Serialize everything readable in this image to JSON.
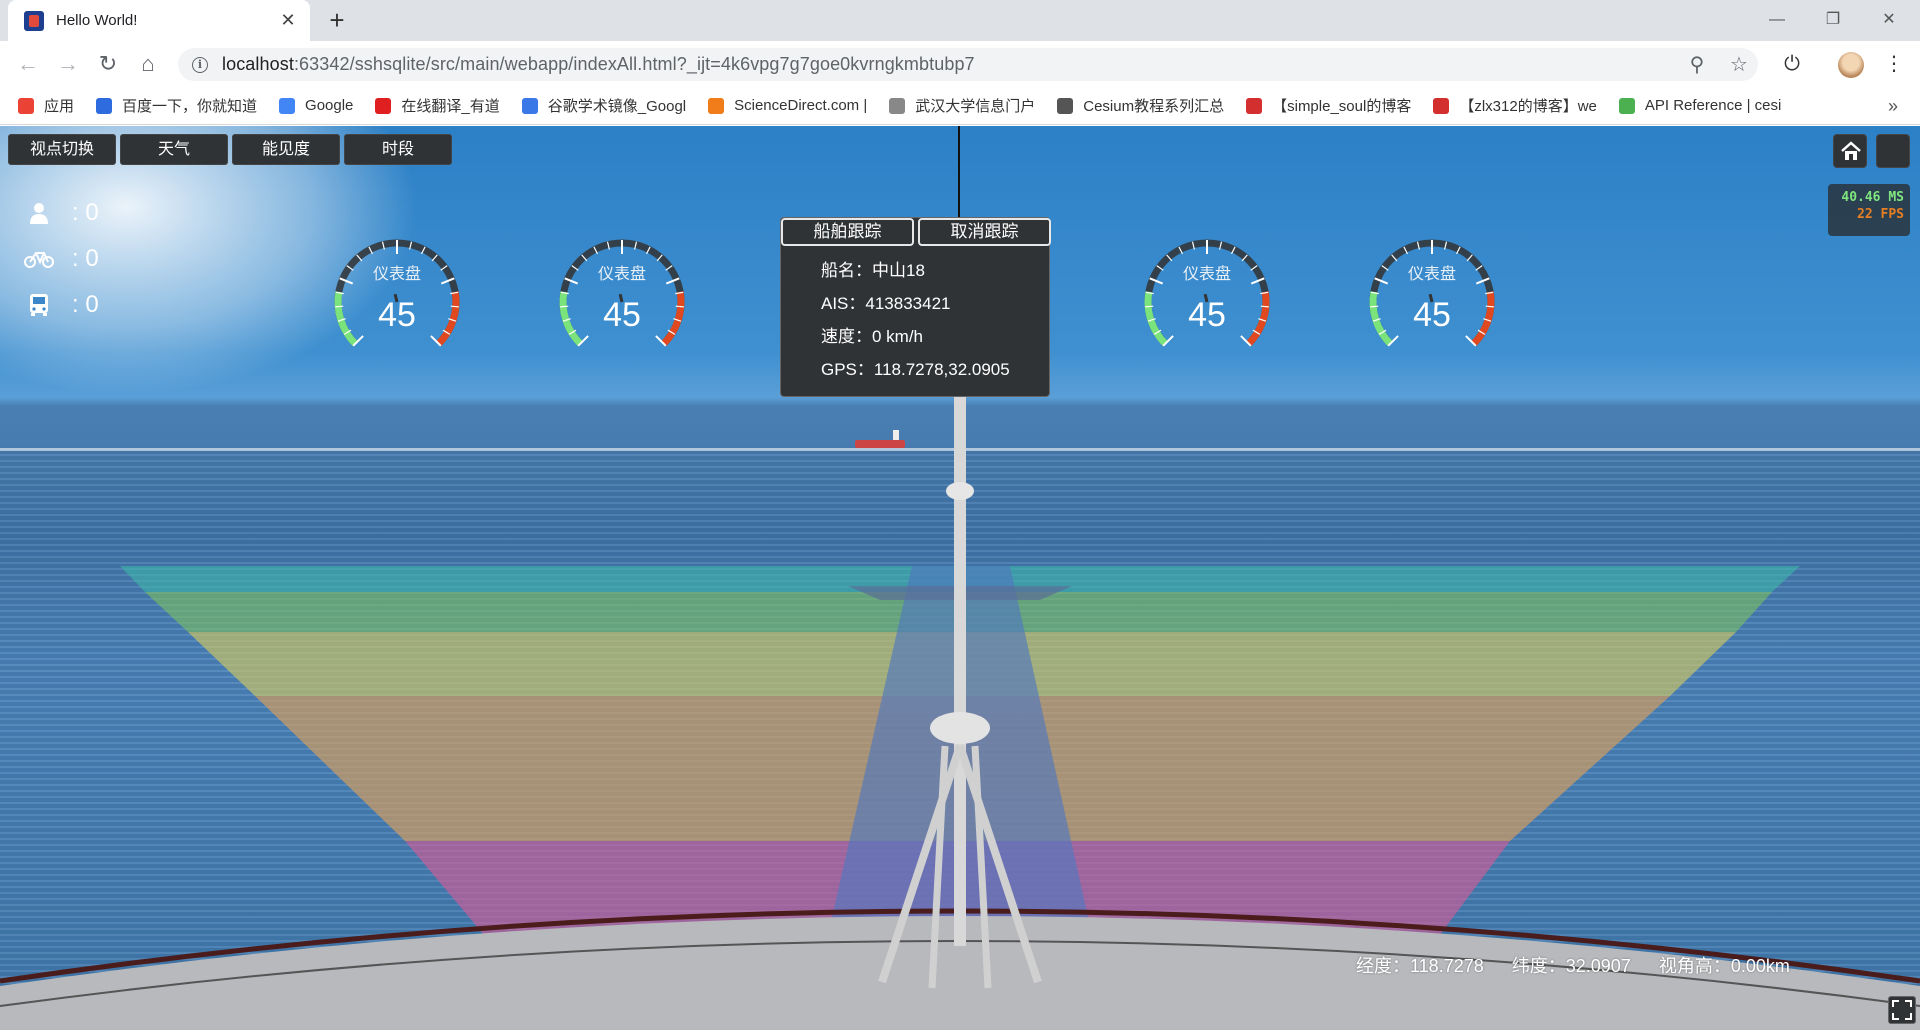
{
  "browser": {
    "tab_title": "Hello World!",
    "url_host": "localhost",
    "url_rest": ":63342/sshsqlite/src/main/webapp/indexAll.html?_ijt=4k6vpg7g7goe0kvrngkmbtubp7",
    "bookmarks": [
      {
        "label": "应用",
        "color": "#ea4335"
      },
      {
        "label": "百度一下，你就知道",
        "color": "#2e6bde"
      },
      {
        "label": "Google",
        "color": "#4285f4"
      },
      {
        "label": "在线翻译_有道",
        "color": "#e02020"
      },
      {
        "label": "谷歌学术镜像_Googl",
        "color": "#3b78e7"
      },
      {
        "label": "ScienceDirect.com |",
        "color": "#f07d1a"
      },
      {
        "label": "武汉大学信息门户",
        "color": "#888888"
      },
      {
        "label": "Cesium教程系列汇总",
        "color": "#555555"
      },
      {
        "label": "【simple_soul的博客",
        "color": "#d32f2f"
      },
      {
        "label": "【zlx312的博客】we",
        "color": "#d32f2f"
      },
      {
        "label": "API Reference | cesi",
        "color": "#4caf50"
      }
    ],
    "more_symbol": "»"
  },
  "toolbar_buttons": [
    "视点切换",
    "天气",
    "能见度",
    "时段"
  ],
  "performance": {
    "ms": "40.46 MS",
    "fps": "22 FPS"
  },
  "counters": [
    {
      "icon": "person-icon",
      "value": ": 0"
    },
    {
      "icon": "bicycle-icon",
      "value": ": 0"
    },
    {
      "icon": "bus-icon",
      "value": ": 0"
    }
  ],
  "gauges": [
    {
      "title": "仪表盘",
      "value": 45
    },
    {
      "title": "仪表盘",
      "value": 45
    },
    {
      "title": "仪表盘",
      "value": 45
    },
    {
      "title": "仪表盘",
      "value": 45
    }
  ],
  "popup": {
    "track_label": "船舶跟踪",
    "cancel_label": "取消跟踪",
    "lines": [
      "船名：中山18",
      "AIS：413833421",
      "速度：0 km/h",
      "GPS：118.7278,32.0905"
    ]
  },
  "coords": {
    "lon": "经度：118.7278",
    "lat": "纬度：32.0907",
    "height": "视角高：0.00km"
  },
  "colors": {
    "panel": "#303336",
    "gauge_green": "#7be37b",
    "gauge_red": "#e0491f"
  }
}
